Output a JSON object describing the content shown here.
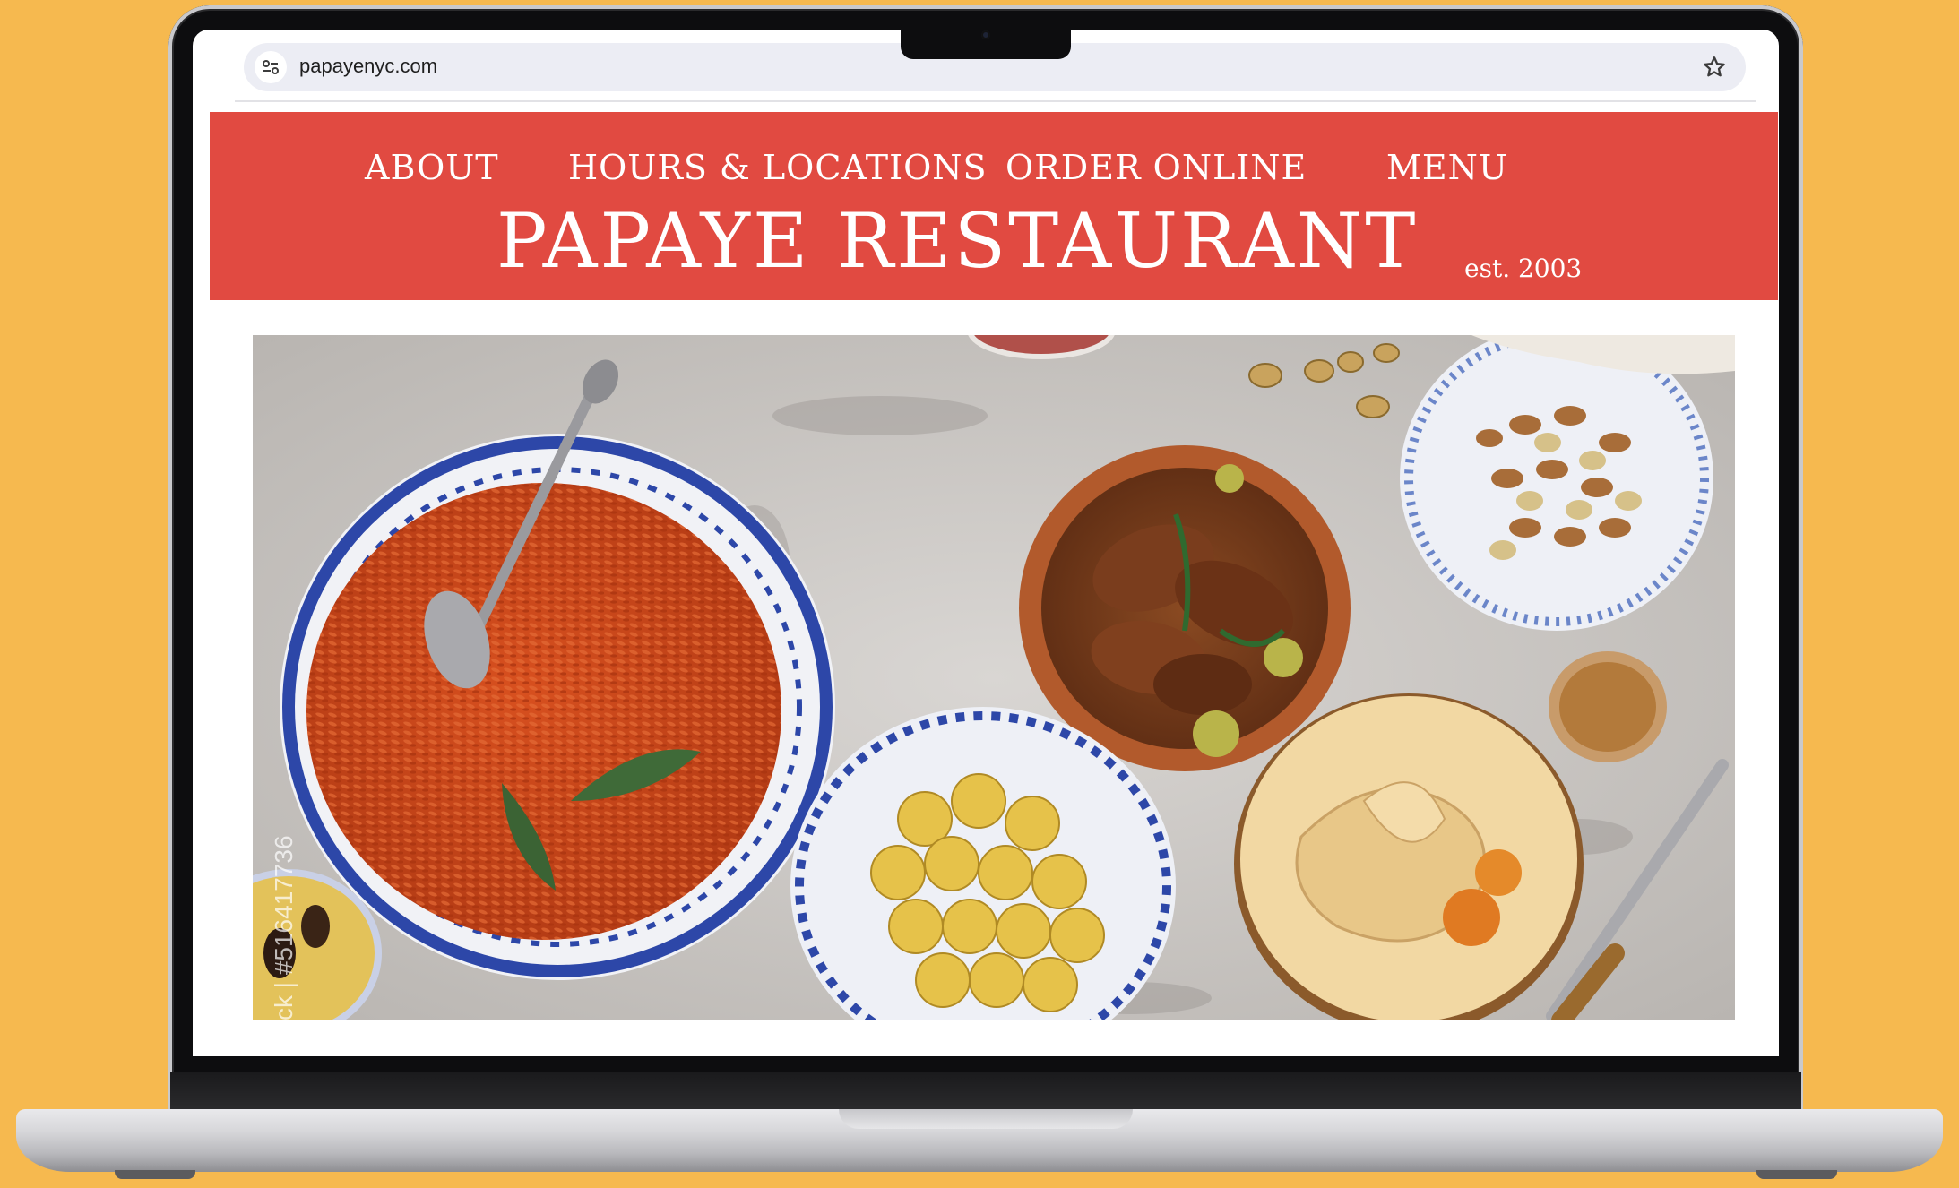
{
  "browser": {
    "url": "papayenyc.com",
    "icons": {
      "site_info": "tune-icon",
      "bookmark": "star-icon"
    }
  },
  "site": {
    "nav": [
      {
        "label": "ABOUT"
      },
      {
        "label": "HOURS & LOCATIONS"
      },
      {
        "label": "ORDER ONLINE"
      },
      {
        "label": "MENU"
      }
    ],
    "brand": "PAPAYE RESTAURANT",
    "established": "est. 2003",
    "colors": {
      "header_bg": "#e14a41",
      "header_text": "#ffffff",
      "page_bg": "#ffffff",
      "backdrop": "#f6b94f"
    }
  },
  "hero": {
    "watermark": "ck | #516417736"
  }
}
